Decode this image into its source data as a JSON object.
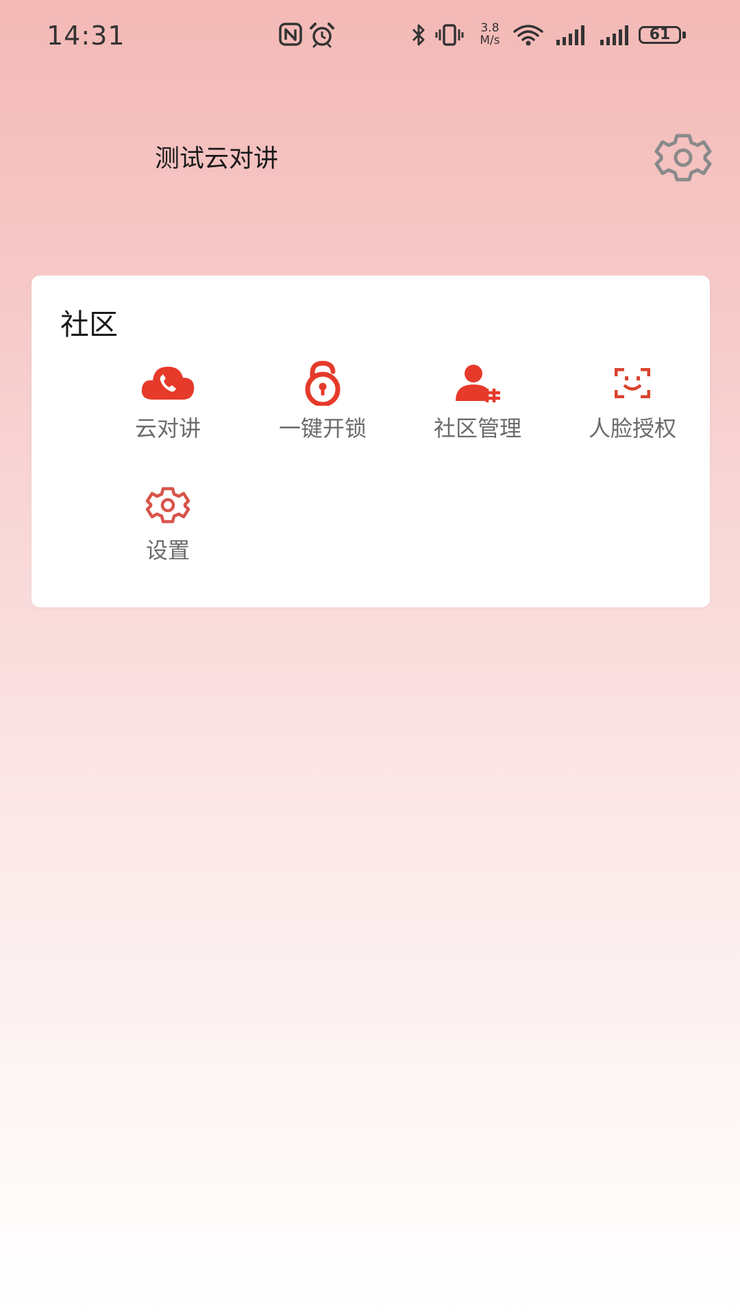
{
  "status_bar": {
    "time": "14:31",
    "net_speed_value": "3.8",
    "net_speed_unit": "M/s",
    "battery_level": "61",
    "icons": [
      "nfc-icon",
      "alarm-icon",
      "bluetooth-icon",
      "vibrate-icon",
      "wifi-icon",
      "signal-icon",
      "signal-icon",
      "battery-icon"
    ]
  },
  "header": {
    "title": "测试云对讲",
    "settings_icon": "gear-icon"
  },
  "community": {
    "title": "社区",
    "items": [
      {
        "label": "云对讲",
        "icon": "cloud-phone-icon"
      },
      {
        "label": "一键开锁",
        "icon": "unlock-icon"
      },
      {
        "label": "社区管理",
        "icon": "community-manage-icon"
      },
      {
        "label": "人脸授权",
        "icon": "face-scan-icon"
      },
      {
        "label": "设置",
        "icon": "gear-icon"
      }
    ]
  },
  "colors": {
    "accent": "#e63a2a",
    "icon_secondary": "#d9544a",
    "label": "#6b6b6b",
    "gradient_top": "#f3b9b6",
    "gradient_bottom": "#ffffff"
  }
}
